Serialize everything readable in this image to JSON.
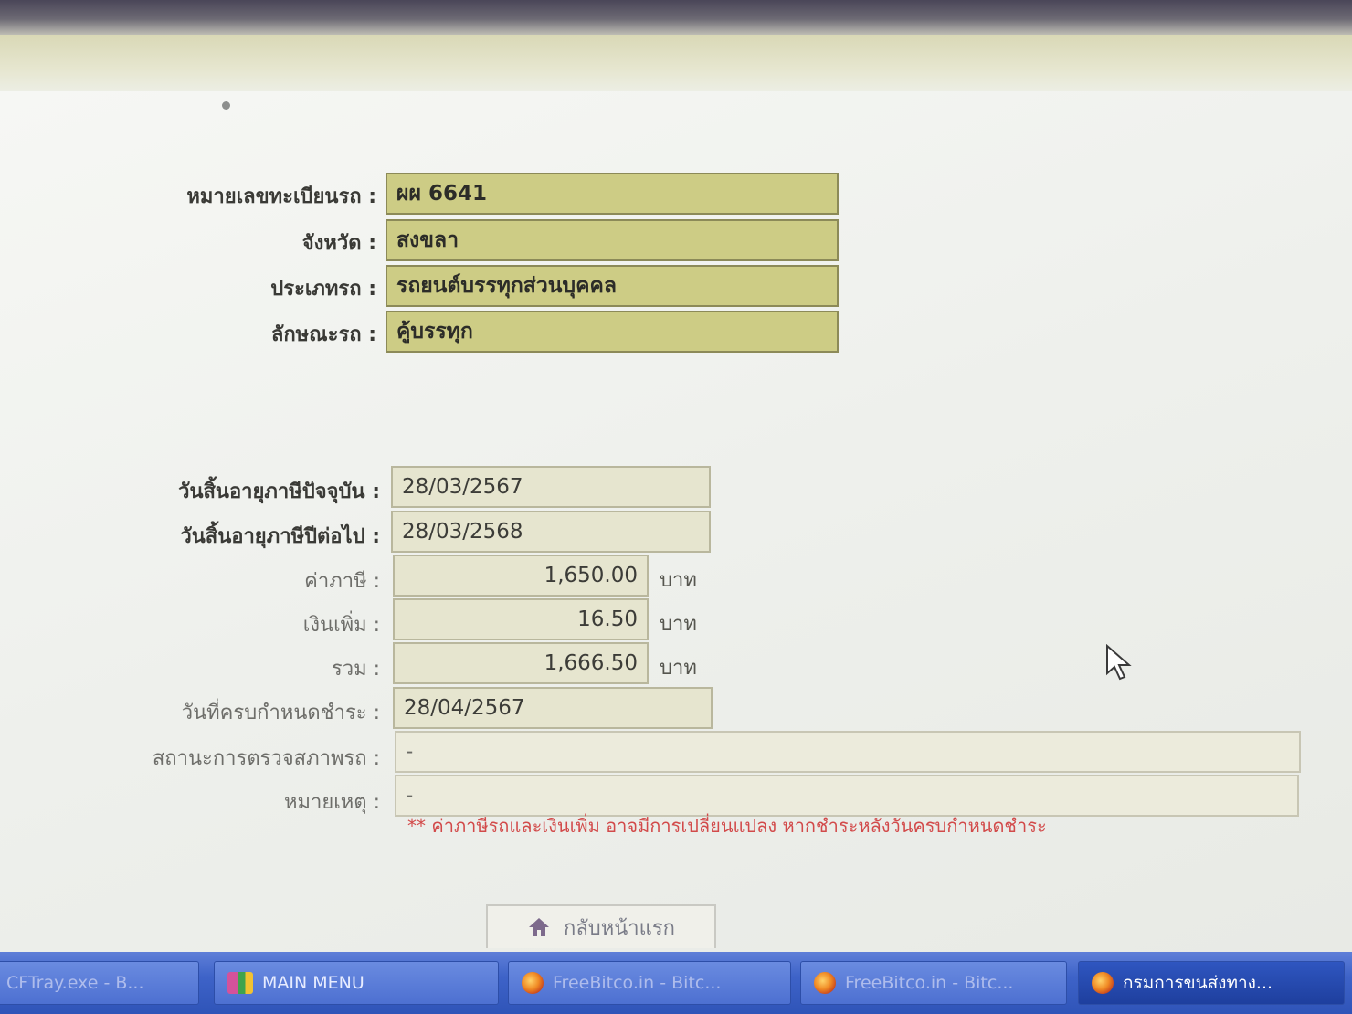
{
  "vehicle": {
    "plate_label": "หมายเลขทะเบียนรถ :",
    "plate_value": "ผผ 6641",
    "province_label": "จังหวัด :",
    "province_value": "สงขลา",
    "type_label": "ประเภทรถ :",
    "type_value": "รถยนต์บรรทุกส่วนบุคคล",
    "style_label": "ลักษณะรถ :",
    "style_value": "คู้บรรทุก"
  },
  "tax": {
    "current_expiry_label": "วันสิ้นอายุภาษีปัจจุบัน :",
    "current_expiry_value": "28/03/2567",
    "next_expiry_label": "วันสิ้นอายุภาษีปีต่อไป :",
    "next_expiry_value": "28/03/2568",
    "tax_label": "ค่าภาษี :",
    "tax_value": "1,650.00",
    "surcharge_label": "เงินเพิ่ม :",
    "surcharge_value": "16.50",
    "total_label": "รวม :",
    "total_value": "1,666.50",
    "currency_unit": "บาท",
    "due_date_label": "วันที่ครบกำหนดชำระ :",
    "due_date_value": "28/04/2567",
    "inspection_label": "สถานะการตรวจสภาพรถ :",
    "inspection_value": "-",
    "remark_label": "หมายเหตุ :",
    "remark_value": "-",
    "warning": "** ค่าภาษีรถและเงินเพิ่ม อาจมีการเปลี่ยนแปลง หากชำระหลังวันครบกำหนดชำระ"
  },
  "actions": {
    "home_label": "กลับหน้าแรก"
  },
  "taskbar": {
    "items": [
      {
        "label": "CFTray.exe - B..."
      },
      {
        "label": "MAIN MENU"
      },
      {
        "label": "FreeBitco.in - Bitc..."
      },
      {
        "label": "FreeBitco.in - Bitc..."
      },
      {
        "label": "กรมการขนส่งทาง..."
      }
    ]
  },
  "colors": {
    "olive_field": "#cdcc85",
    "beige_field": "#e6e5cf",
    "warning_text": "#d24a4a",
    "taskbar": "#3e63c8"
  }
}
